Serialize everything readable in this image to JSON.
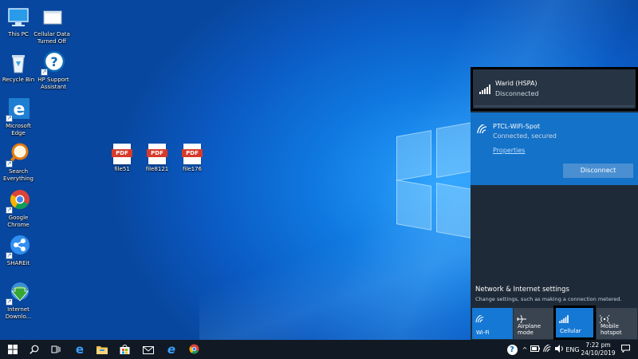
{
  "desktop": {
    "icons": [
      {
        "label": "This PC",
        "icon": "this-pc-icon"
      },
      {
        "label": "Cellular Data Turned Off",
        "icon": "notepad-file-icon"
      },
      {
        "label": "Recycle Bin",
        "icon": "recycle-bin-icon"
      },
      {
        "label": "HP Support Assistant",
        "icon": "hp-support-icon"
      },
      {
        "label": "Microsoft Edge",
        "icon": "edge-icon"
      },
      {
        "label": "Search Everything",
        "icon": "search-everything-icon"
      },
      {
        "label": "Google Chrome",
        "icon": "chrome-icon"
      },
      {
        "label": "SHAREit",
        "icon": "shareit-icon"
      },
      {
        "label": "Internet Downlo...",
        "icon": "internet-download-manager-icon"
      }
    ],
    "files": [
      {
        "label": "file51",
        "badge": "PDF"
      },
      {
        "label": "file8121",
        "badge": "PDF"
      },
      {
        "label": "file176",
        "badge": "PDF"
      }
    ]
  },
  "network_flyout": {
    "networks": [
      {
        "name": "Warid (HSPA)",
        "status": "Disconnected",
        "icon": "cellular-signal-icon"
      },
      {
        "name": "PTCL-WiFi-Spot",
        "status": "Connected, secured",
        "icon": "wifi-icon",
        "properties_label": "Properties",
        "disconnect_label": "Disconnect"
      }
    ],
    "settings_title": "Network & Internet settings",
    "settings_subtitle": "Change settings, such as making a connection metered.",
    "quick_actions": [
      {
        "label": "Wi-Fi",
        "icon": "wifi-icon",
        "active": true
      },
      {
        "label": "Airplane mode",
        "icon": "airplane-icon",
        "active": false
      },
      {
        "label": "Cellular",
        "icon": "cellular-signal-icon",
        "active": true
      },
      {
        "label": "Mobile hotspot",
        "icon": "hotspot-icon",
        "active": false
      }
    ]
  },
  "taskbar": {
    "apps": [
      "start-icon",
      "search-icon",
      "task-view-icon",
      "edge-icon",
      "file-explorer-icon",
      "store-icon",
      "mail-icon",
      "internet-explorer-icon",
      "chrome-icon"
    ],
    "tray": {
      "language": "ENG",
      "time": "7:22 pm",
      "date": "24/10/2019"
    }
  },
  "colors": {
    "accent": "#1472c8",
    "tile_active": "#1478d4",
    "flyout_bg": "#1f2a38",
    "taskbar_bg": "#111a24"
  }
}
